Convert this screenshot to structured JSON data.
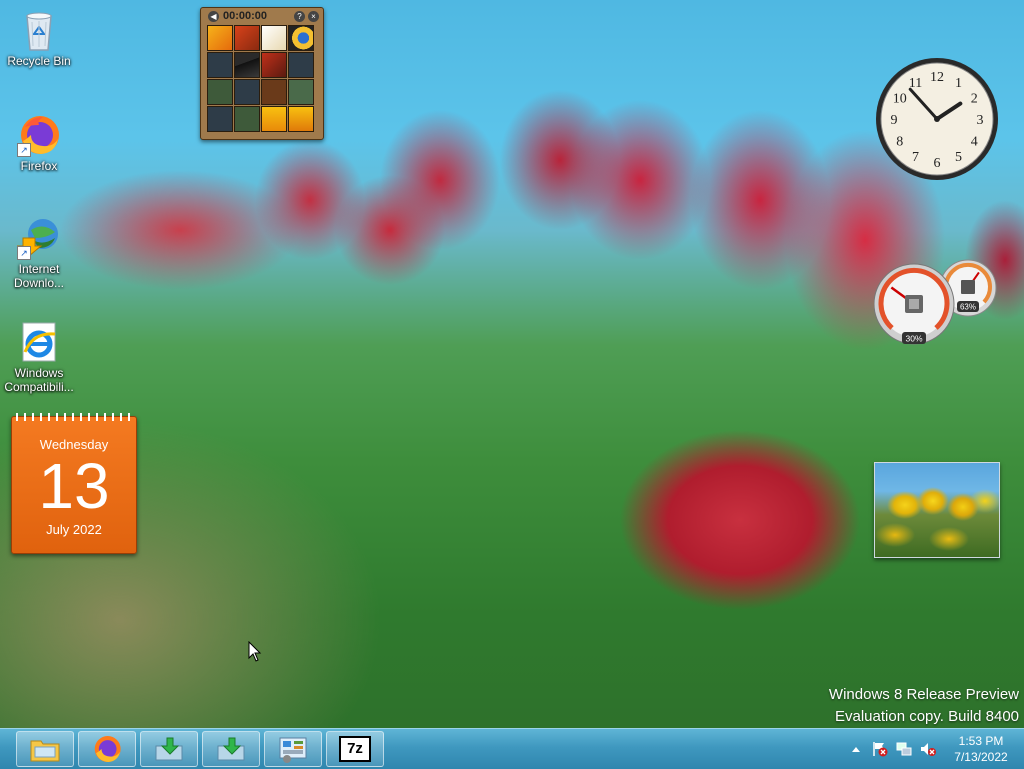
{
  "desktop": {
    "icons": [
      {
        "label": "Recycle Bin",
        "icon": "recycle-bin-icon"
      },
      {
        "label": "Firefox",
        "icon": "firefox-icon"
      },
      {
        "label": "Internet Downlo...",
        "icon": "internet-download-manager-icon"
      },
      {
        "label": "Windows Compatibili...",
        "icon": "internet-explorer-icon"
      }
    ]
  },
  "gadgets": {
    "calendar": {
      "weekday": "Wednesday",
      "day": "13",
      "month_year": "July 2022"
    },
    "puzzle": {
      "timer": "00:00:00",
      "help_label": "?",
      "close_label": "×"
    },
    "clock": {
      "hour": 1,
      "minute": 53,
      "numerals": [
        "12",
        "1",
        "2",
        "3",
        "4",
        "5",
        "6",
        "7",
        "8",
        "9",
        "10",
        "11"
      ]
    },
    "cpu_meter": {
      "cpu_label": "30%",
      "cpu_value": 0.3,
      "memory_label": "63%",
      "memory_value": 0.63
    }
  },
  "watermark": {
    "line1": "Windows 8 Release Preview",
    "line2": "Evaluation copy. Build 8400"
  },
  "taskbar": {
    "buttons": [
      {
        "name": "file-explorer",
        "icon": "folder-icon"
      },
      {
        "name": "firefox",
        "icon": "firefox-icon"
      },
      {
        "name": "download-1",
        "icon": "download-arrow-icon"
      },
      {
        "name": "download-2",
        "icon": "download-arrow-icon"
      },
      {
        "name": "control-panel",
        "icon": "control-panel-icon"
      },
      {
        "name": "7zip",
        "icon": "7zip-icon",
        "label": "7z"
      }
    ],
    "tray": {
      "time": "1:53 PM",
      "date": "7/13/2022",
      "icons": [
        "show-hidden-icons-arrow",
        "action-center-flag-icon",
        "network-icon",
        "volume-muted-icon"
      ]
    }
  },
  "colors": {
    "calendar_orange": "#e8690f",
    "taskbar_blue": "#3f98bf",
    "tray_alert_red": "#d21f1f"
  }
}
